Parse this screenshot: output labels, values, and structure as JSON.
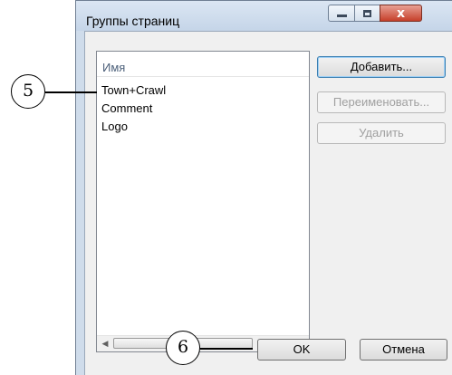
{
  "window": {
    "title": "Группы страниц",
    "controls": {
      "minimize": "minimize",
      "maximize": "maximize",
      "close": "x"
    }
  },
  "list": {
    "column_header": "Имя",
    "items": [
      "Town+Crawl",
      "Comment",
      "Logo"
    ],
    "scrollbar_thumb_glyph": "III"
  },
  "buttons": {
    "add": "Добавить...",
    "rename": "Переименовать...",
    "delete": "Удалить",
    "ok": "OK",
    "cancel": "Отмена"
  },
  "callouts": {
    "first": "5",
    "second": "6"
  }
}
